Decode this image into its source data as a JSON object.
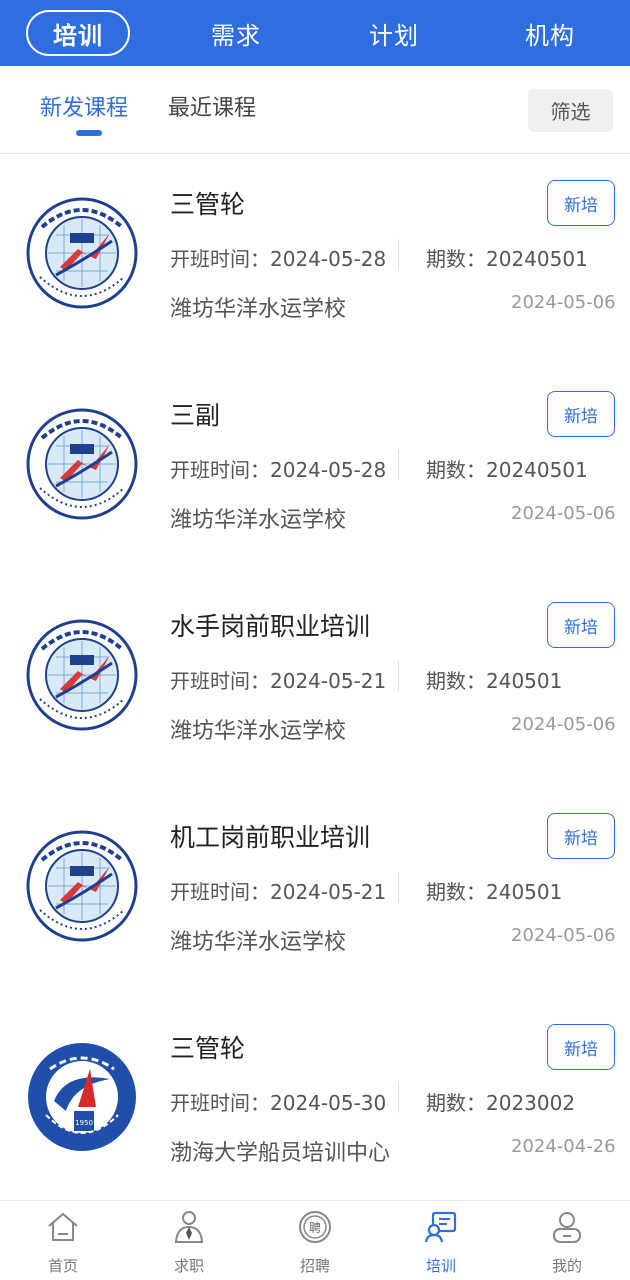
{
  "top_tabs": [
    "培训",
    "需求",
    "计划",
    "机构"
  ],
  "sub_tabs": [
    "新发课程",
    "最近课程"
  ],
  "filter_label": "筛选",
  "courses": [
    {
      "title": "三管轮",
      "badge": "新培",
      "start_label": "开班时间：2024-05-28",
      "period_label": "期数：20240501",
      "school": "潍坊华洋水运学校",
      "date": "2024-05-06",
      "logo": "weifang-marine-academy-logo"
    },
    {
      "title": "三副",
      "badge": "新培",
      "start_label": "开班时间：2024-05-28",
      "period_label": "期数：20240501",
      "school": "潍坊华洋水运学校",
      "date": "2024-05-06",
      "logo": "weifang-marine-academy-logo"
    },
    {
      "title": "水手岗前职业培训",
      "badge": "新培",
      "start_label": "开班时间：2024-05-21",
      "period_label": "期数：240501",
      "school": "潍坊华洋水运学校",
      "date": "2024-05-06",
      "logo": "weifang-marine-academy-logo"
    },
    {
      "title": "机工岗前职业培训",
      "badge": "新培",
      "start_label": "开班时间：2024-05-21",
      "period_label": "期数：240501",
      "school": "潍坊华洋水运学校",
      "date": "2024-05-06",
      "logo": "weifang-marine-academy-logo"
    },
    {
      "title": "三管轮",
      "badge": "新培",
      "start_label": "开班时间：2024-05-30",
      "period_label": "期数：2023002",
      "school": "渤海大学船员培训中心",
      "date": "2024-04-26",
      "logo": "bohai-university-logo"
    }
  ],
  "bottom_nav": [
    {
      "label": "首页",
      "icon": "home-icon"
    },
    {
      "label": "求职",
      "icon": "job-seeker-icon"
    },
    {
      "label": "招聘",
      "icon": "recruit-icon"
    },
    {
      "label": "培训",
      "icon": "training-icon"
    },
    {
      "label": "我的",
      "icon": "profile-icon"
    }
  ],
  "colors": {
    "brand": "#2f6ee0",
    "text_muted": "#999999"
  }
}
